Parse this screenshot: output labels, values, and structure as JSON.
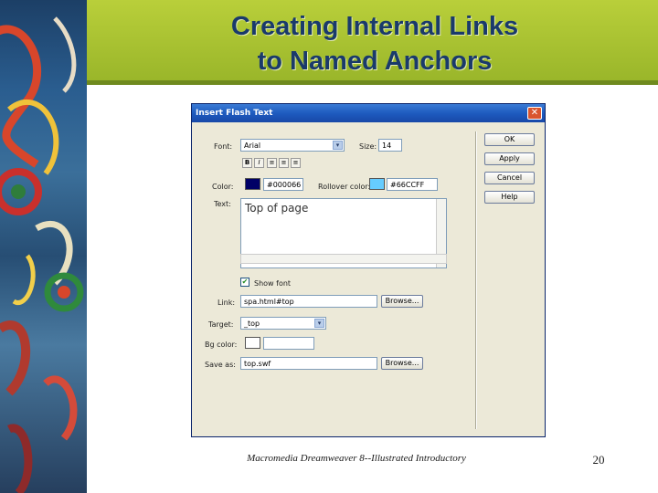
{
  "slide": {
    "title_line1": "Creating Internal Links",
    "title_line2": "to Named Anchors",
    "footer": "Macromedia Dreamweaver 8--Illustrated Introductory",
    "page_number": "20"
  },
  "dialog": {
    "title": "Insert Flash Text",
    "close_glyph": "✕",
    "font_label": "Font:",
    "font_value": "Arial",
    "size_label": "Size:",
    "size_value": "14",
    "format_buttons": [
      "B",
      "I",
      "≡",
      "≡",
      "≡"
    ],
    "color_label": "Color:",
    "color_value": "#000066",
    "rollover_label": "Rollover color:",
    "rollover_value": "#66CCFF",
    "text_label": "Text:",
    "text_value": "Top of page",
    "show_font_label": "Show font",
    "show_font_checked": true,
    "link_label": "Link:",
    "link_value": "spa.html#top",
    "link_browse": "Browse...",
    "target_label": "Target:",
    "target_value": "_top",
    "bgcolor_label": "Bg color:",
    "bgcolor_value": "",
    "saveas_label": "Save as:",
    "saveas_value": "top.swf",
    "saveas_browse": "Browse...",
    "buttons": {
      "ok": "OK",
      "apply": "Apply",
      "cancel": "Cancel",
      "help": "Help"
    }
  },
  "colors": {
    "text_color": "#000066",
    "rollover_color": "#66CCFF",
    "banner": "#A9C232",
    "title_text": "#1A3A6B"
  },
  "icons": {
    "checkbox_check": "✔",
    "dropdown_arrow": "▾"
  }
}
